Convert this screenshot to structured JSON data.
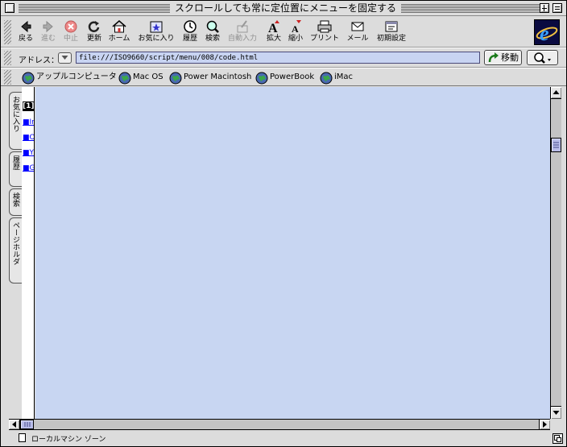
{
  "window": {
    "title": "スクロールしても常に定位置にメニューを固定する"
  },
  "toolbar": {
    "buttons": [
      {
        "label": "戻る",
        "icon": "back-arrow-icon",
        "enabled": true
      },
      {
        "label": "進む",
        "icon": "forward-arrow-icon",
        "enabled": false
      },
      {
        "label": "中止",
        "icon": "stop-icon",
        "enabled": false
      },
      {
        "label": "更新",
        "icon": "refresh-icon",
        "enabled": true
      },
      {
        "label": "ホーム",
        "icon": "home-icon",
        "enabled": true
      },
      {
        "label": "お気に入り",
        "icon": "favorites-icon",
        "enabled": true
      },
      {
        "label": "履歴",
        "icon": "history-icon",
        "enabled": true
      },
      {
        "label": "検索",
        "icon": "search-icon",
        "enabled": true
      },
      {
        "label": "自動入力",
        "icon": "autofill-icon",
        "enabled": false
      },
      {
        "label": "拡大",
        "icon": "text-larger-icon",
        "enabled": true
      },
      {
        "label": "縮小",
        "icon": "text-smaller-icon",
        "enabled": true
      },
      {
        "label": "プリント",
        "icon": "print-icon",
        "enabled": true
      },
      {
        "label": "メール",
        "icon": "mail-icon",
        "enabled": true
      },
      {
        "label": "初期設定",
        "icon": "preferences-icon",
        "enabled": true
      }
    ]
  },
  "address": {
    "label": "アドレス：",
    "url": "file:///ISO9660/script/menu/008/code.html",
    "go_label": "移動"
  },
  "favorites": {
    "items": [
      {
        "label": "アップルコンピュータ"
      },
      {
        "label": "Mac OS"
      },
      {
        "label": "Power Macintosh"
      },
      {
        "label": "PowerBook"
      },
      {
        "label": "iMac"
      }
    ]
  },
  "explorer_tabs": [
    {
      "label": "お気に入り"
    },
    {
      "label": "履歴"
    },
    {
      "label": "検索"
    },
    {
      "label": "ページホルダ"
    }
  ],
  "side_menu": {
    "items": [
      {
        "label": "[1]"
      },
      {
        "label": "■In"
      },
      {
        "label": "■O"
      },
      {
        "label": "■Y"
      },
      {
        "label": "■G"
      }
    ]
  },
  "status": {
    "zone": "ローカルマシン ゾーン"
  },
  "colors": {
    "content_bg": "#c8d6f2",
    "address_bg": "#c8d4f2",
    "scroll_thumb": "#b8bce8",
    "link": "#0000ff"
  }
}
